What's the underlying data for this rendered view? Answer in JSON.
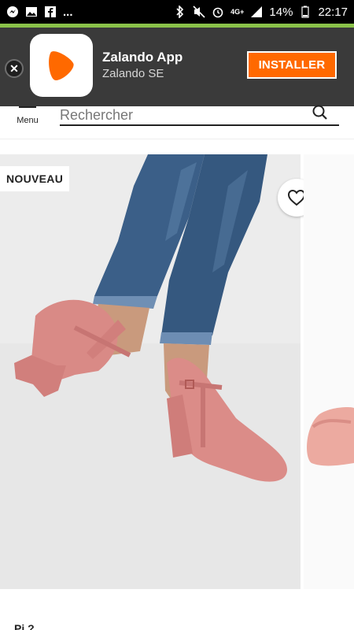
{
  "status_bar": {
    "left_icons": [
      "messenger-icon",
      "image-icon",
      "facebook-icon",
      "more-icon"
    ],
    "overflow": "...",
    "network": "4G+",
    "battery": "14%",
    "time": "22:17"
  },
  "app_banner": {
    "title": "Zalando App",
    "subtitle": "Zalando SE",
    "install_label": "INSTALLER",
    "close_glyph": "✕"
  },
  "header": {
    "menu_label": "Menu",
    "search_placeholder": "Rechercher"
  },
  "product": {
    "badge": "NOUVEAU",
    "brand_partial": "Pi  ?"
  },
  "colors": {
    "brand_orange": "#ff6900",
    "accent_green": "#8bc34a",
    "banner_bg": "#3a3a3a"
  }
}
